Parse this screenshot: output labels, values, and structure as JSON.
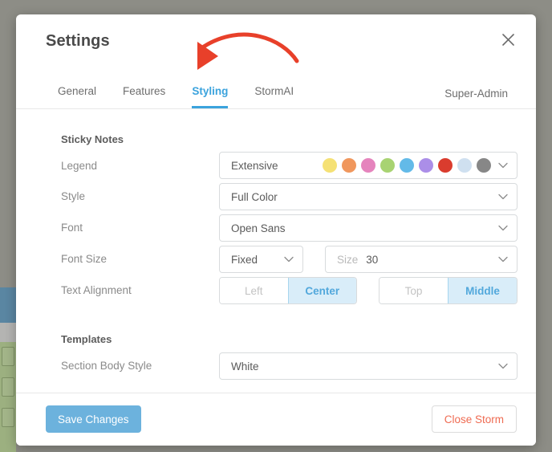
{
  "modal": {
    "title": "Settings",
    "close_icon": "close-icon"
  },
  "tabs": [
    {
      "label": "General",
      "active": false
    },
    {
      "label": "Features",
      "active": false
    },
    {
      "label": "Styling",
      "active": true
    },
    {
      "label": "StormAI",
      "active": false
    }
  ],
  "tabs_right": {
    "label": "Super-Admin"
  },
  "sections": {
    "sticky_notes": {
      "title": "Sticky Notes",
      "legend": {
        "label": "Legend",
        "value": "Extensive",
        "swatches": [
          "#f5e175",
          "#f0975d",
          "#e584bd",
          "#a8d372",
          "#63bae8",
          "#ab8ee8",
          "#da3c2e",
          "#cfe0f0",
          "#878787"
        ]
      },
      "style": {
        "label": "Style",
        "value": "Full Color"
      },
      "font": {
        "label": "Font",
        "value": "Open Sans"
      },
      "font_size": {
        "label": "Font Size",
        "mode_value": "Fixed",
        "size_placeholder": "Size",
        "size_value": "30"
      },
      "text_alignment": {
        "label": "Text Alignment",
        "horizontal": {
          "options": [
            "Left",
            "Center"
          ],
          "selected": "Center"
        },
        "vertical": {
          "options": [
            "Top",
            "Middle"
          ],
          "selected": "Middle"
        }
      }
    },
    "templates": {
      "title": "Templates",
      "section_body_style": {
        "label": "Section Body Style",
        "value": "White"
      }
    }
  },
  "footer": {
    "save_label": "Save Changes",
    "close_storm_label": "Close Storm"
  },
  "annotation": {
    "arrow_color": "#e8402a",
    "points_to": "Styling"
  },
  "colors": {
    "accent_blue": "#3ba3dd",
    "save_button": "#6cb2dd",
    "danger_text": "#ef6b52",
    "backdrop": "#8d8d86"
  }
}
